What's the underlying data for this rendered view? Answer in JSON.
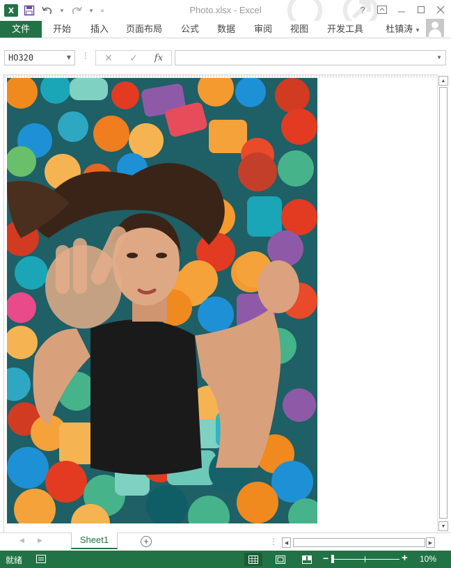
{
  "app": {
    "title": "Photo.xlsx - Excel",
    "logo_text": "X",
    "brand_color": "#217346"
  },
  "qat": {
    "icons": [
      "excel-logo",
      "save-icon",
      "undo-icon",
      "redo-icon",
      "customize-icon"
    ]
  },
  "window_controls": {
    "help": "?",
    "icons": [
      "help-icon",
      "ribbon-display-icon",
      "minimize-icon",
      "restore-icon",
      "close-icon"
    ]
  },
  "ribbon": {
    "tabs": [
      "文件",
      "开始",
      "插入",
      "页面布局",
      "公式",
      "数据",
      "审阅",
      "视图",
      "开发工具"
    ],
    "user": "杜镇涛"
  },
  "formula_bar": {
    "name_box": "HO320",
    "formula": "",
    "fx_label": "fx"
  },
  "sheet": {
    "tabs": [
      "Sheet1"
    ],
    "active_tab": "Sheet1"
  },
  "status_bar": {
    "status": "就绪",
    "zoom": "10%",
    "zoom_fraction": 0.1
  }
}
